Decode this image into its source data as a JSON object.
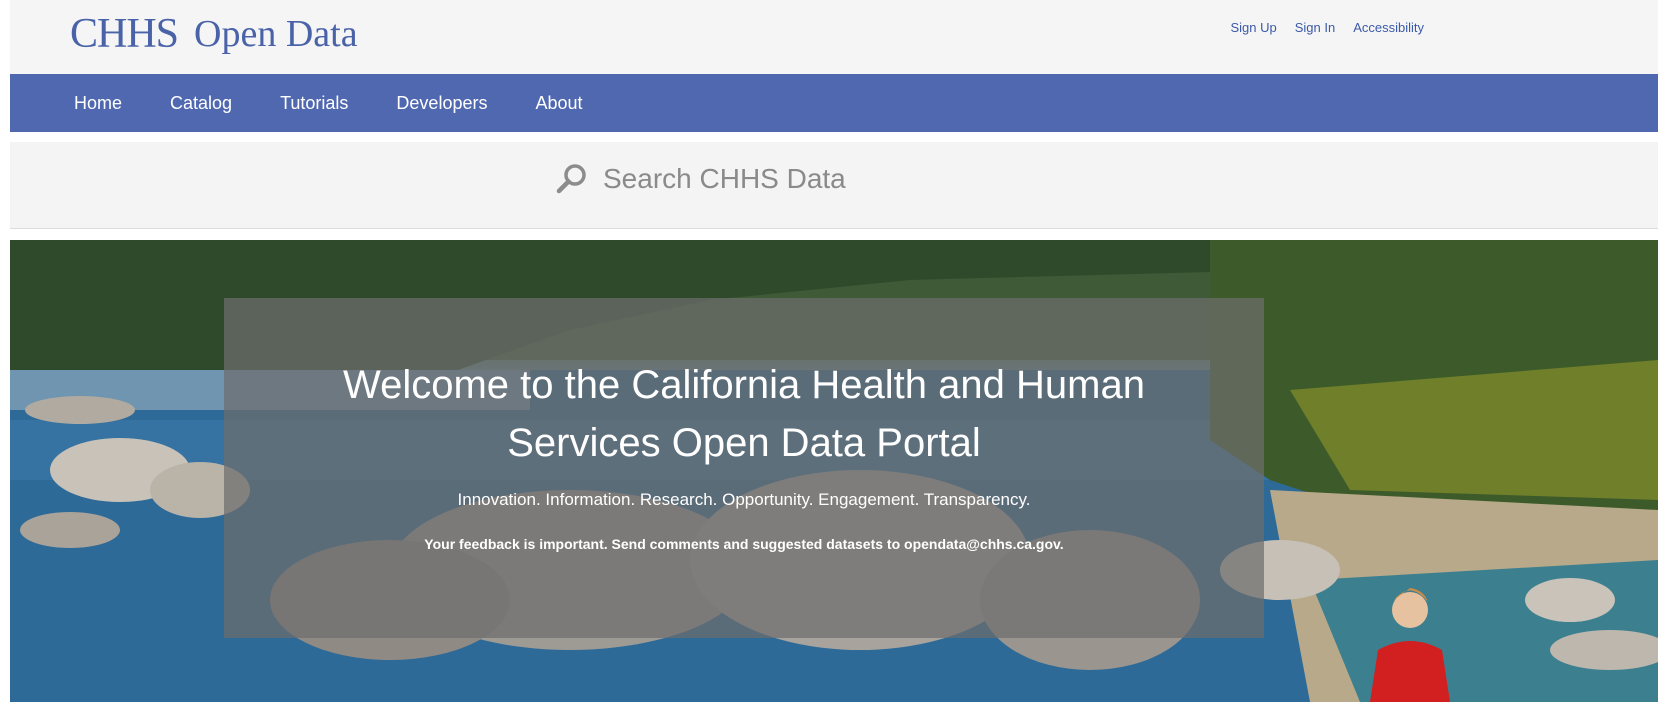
{
  "header": {
    "logo_mark": "CHHS",
    "logo_text": "Open Data",
    "links": [
      "Sign Up",
      "Sign In",
      "Accessibility"
    ]
  },
  "nav": {
    "items": [
      "Home",
      "Catalog",
      "Tutorials",
      "Developers",
      "About"
    ]
  },
  "search": {
    "placeholder": "Search CHHS Data"
  },
  "hero": {
    "title": "Welcome to the California Health and Human Services Open Data Portal",
    "tagline": "Innovation. Information. Research. Opportunity. Engagement. Transparency.",
    "feedback": "Your feedback is important. Send comments and suggested datasets to opendata@chhs.ca.gov."
  },
  "colors": {
    "brand": "#4a63a8",
    "nav_bg": "#5068b0",
    "header_bg": "#f5f5f5",
    "overlay": "#6e6e6e"
  }
}
